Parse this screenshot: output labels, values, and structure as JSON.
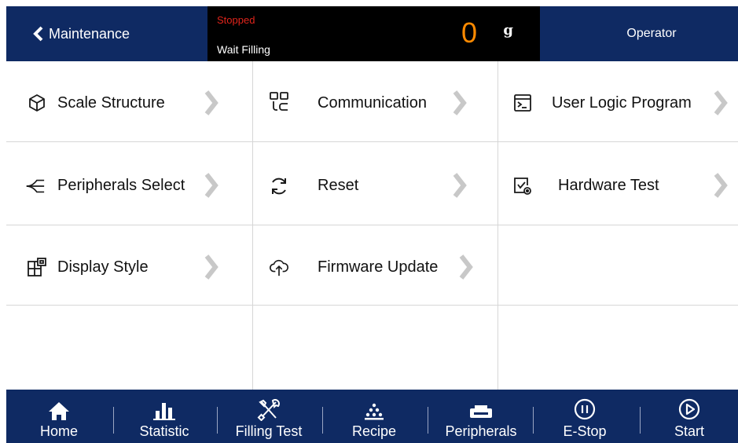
{
  "header": {
    "back_label": "Maintenance",
    "status_state": "Stopped",
    "status_message": "Wait Filling",
    "weight_value": "0",
    "weight_unit": "g",
    "user_role": "Operator"
  },
  "colors": {
    "header_bg": "#0f2a63",
    "status_bg": "#000000",
    "stopped_text": "#e0241b",
    "weight_text": "#ff8a00",
    "arrow": "#c8c8c8",
    "grid_line": "#d6d6d6"
  },
  "menu": [
    {
      "label": "Scale Structure",
      "icon": "cube-icon"
    },
    {
      "label": "Communication",
      "icon": "communication-icon"
    },
    {
      "label": "User Logic Program",
      "icon": "terminal-icon"
    },
    {
      "label": "Peripherals Select",
      "icon": "fork-icon"
    },
    {
      "label": "Reset",
      "icon": "refresh-icon"
    },
    {
      "label": "Hardware Test",
      "icon": "hardware-check-icon"
    },
    {
      "label": "Display Style",
      "icon": "layout-icon"
    },
    {
      "label": "Firmware Update",
      "icon": "cloud-upload-icon"
    }
  ],
  "footer": [
    {
      "label": "Home",
      "icon": "home-icon"
    },
    {
      "label": "Statistic",
      "icon": "bar-chart-icon"
    },
    {
      "label": "Filling Test",
      "icon": "tools-icon"
    },
    {
      "label": "Recipe",
      "icon": "recipe-icon"
    },
    {
      "label": "Peripherals",
      "icon": "printer-icon"
    },
    {
      "label": "E-Stop",
      "icon": "pause-circle-icon"
    },
    {
      "label": "Start",
      "icon": "play-circle-icon"
    }
  ]
}
